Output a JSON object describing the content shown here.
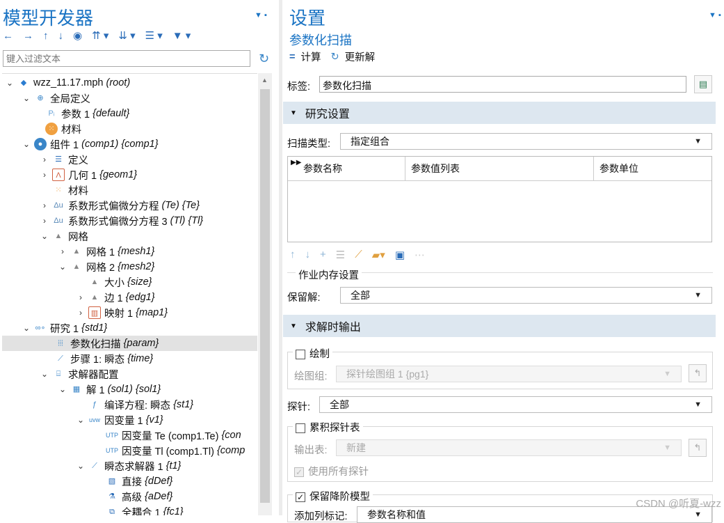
{
  "left": {
    "title": "模型开发器",
    "filter_placeholder": "键入过滤文本",
    "tree": [
      {
        "label": "wzz_11.17.mph",
        "tag": "(root)"
      },
      {
        "label": "全局定义",
        "tag": ""
      },
      {
        "label": "参数 1",
        "tag": "{default}"
      },
      {
        "label": "材料",
        "tag": ""
      },
      {
        "label": "组件 1",
        "tag": "(comp1) {comp1}"
      },
      {
        "label": "定义",
        "tag": ""
      },
      {
        "label": "几何 1",
        "tag": "{geom1}"
      },
      {
        "label": "材料",
        "tag": ""
      },
      {
        "label": "系数形式偏微分方程",
        "tag": "(Te) {Te}"
      },
      {
        "label": "系数形式偏微分方程 3",
        "tag": "(Tl) {Tl}"
      },
      {
        "label": "网格",
        "tag": ""
      },
      {
        "label": "网格 1",
        "tag": "{mesh1}"
      },
      {
        "label": "网格 2",
        "tag": "{mesh2}"
      },
      {
        "label": "大小",
        "tag": "{size}"
      },
      {
        "label": "边 1",
        "tag": "{edg1}"
      },
      {
        "label": "映射 1",
        "tag": "{map1}"
      },
      {
        "label": "研究 1",
        "tag": "{std1}"
      },
      {
        "label": "参数化扫描",
        "tag": "{param}"
      },
      {
        "label": "步骤 1: 瞬态",
        "tag": "{time}"
      },
      {
        "label": "求解器配置",
        "tag": ""
      },
      {
        "label": "解 1",
        "tag": "(sol1) {sol1}"
      },
      {
        "label": "编译方程: 瞬态",
        "tag": "{st1}"
      },
      {
        "label": "因变量 1",
        "tag": "{v1}"
      },
      {
        "label": "因变量 Te (comp1.Te)",
        "tag": "{con"
      },
      {
        "label": "因变量 Tl (comp1.Tl)",
        "tag": "{comp"
      },
      {
        "label": "瞬态求解器 1",
        "tag": "{t1}"
      },
      {
        "label": "直接",
        "tag": "{dDef}"
      },
      {
        "label": "高级",
        "tag": "{aDef}"
      },
      {
        "label": "全耦合 1",
        "tag": "{fc1}"
      }
    ]
  },
  "right": {
    "title": "设置",
    "subtitle": "参数化扫描",
    "compute": "计算",
    "update": "更新解",
    "label_label": "标签:",
    "label_value": "参数化扫描",
    "sec_study": "研究设置",
    "sweep_type_label": "扫描类型:",
    "sweep_type_value": "指定组合",
    "table_headers": [
      "参数名称",
      "参数值列表",
      "参数单位"
    ],
    "memory_title": "作业内存设置",
    "keep_label": "保留解:",
    "keep_value": "全部",
    "sec_output": "求解时输出",
    "plot_label": "绘制",
    "plot_group_label": "绘图组:",
    "plot_group_value": "探针绘图组 1 {pg1}",
    "probe_label": "探针:",
    "probe_value": "全部",
    "accum_label": "累积探针表",
    "out_table_label": "输出表:",
    "out_table_value": "新建",
    "use_all_label": "使用所有探针",
    "keep_rom_label": "保留降阶模型",
    "add_label": "添加列标记:",
    "add_value": "参数名称和值"
  },
  "watermark": "CSDN @听夏-wzz"
}
